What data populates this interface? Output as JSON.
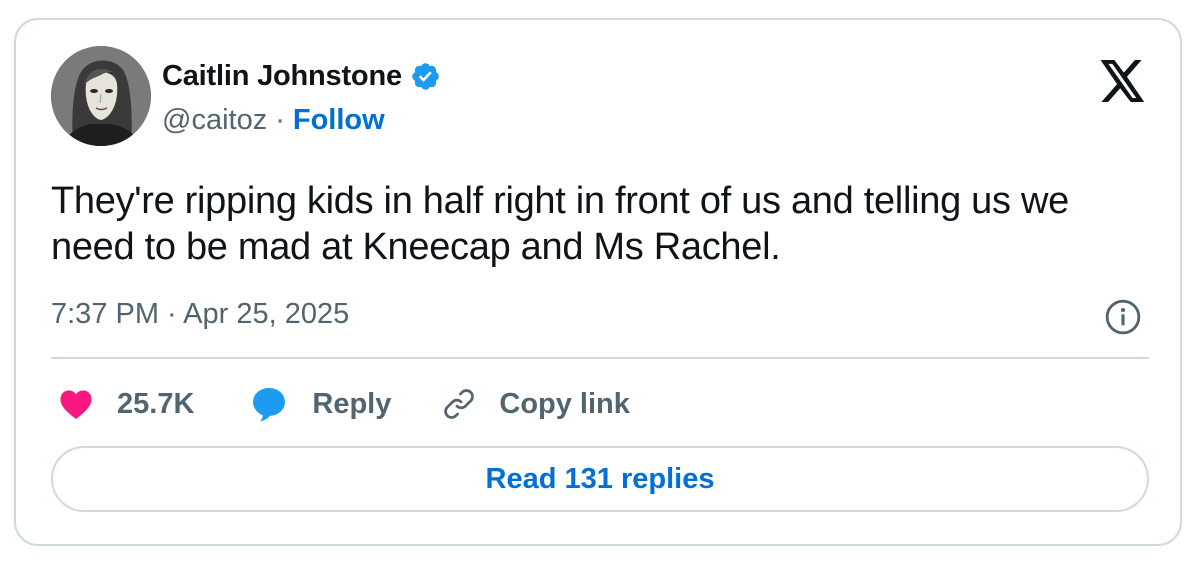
{
  "author": {
    "display_name": "Caitlin Johnstone",
    "handle": "@caitoz",
    "separator": "·",
    "follow_label": "Follow",
    "verified_icon": "verified-badge-icon"
  },
  "tweet": {
    "text": "They're ripping kids in half right in front of us and telling us we need to be mad at Kneecap and Ms Rachel.",
    "timestamp": "7:37 PM · Apr 25, 2025"
  },
  "actions": {
    "like_count": "25.7K",
    "reply_label": "Reply",
    "copy_link_label": "Copy link"
  },
  "read_replies_label": "Read 131 replies",
  "icons": {
    "brand": "x-logo-icon",
    "info": "info-icon",
    "like": "heart-icon",
    "reply": "speech-bubble-icon",
    "copy": "link-icon"
  },
  "colors": {
    "accent_blue": "#006fd6",
    "like_pink": "#f91880",
    "reply_blue": "#1d9bf0",
    "muted_text": "#536471",
    "border": "#cfd9de"
  }
}
